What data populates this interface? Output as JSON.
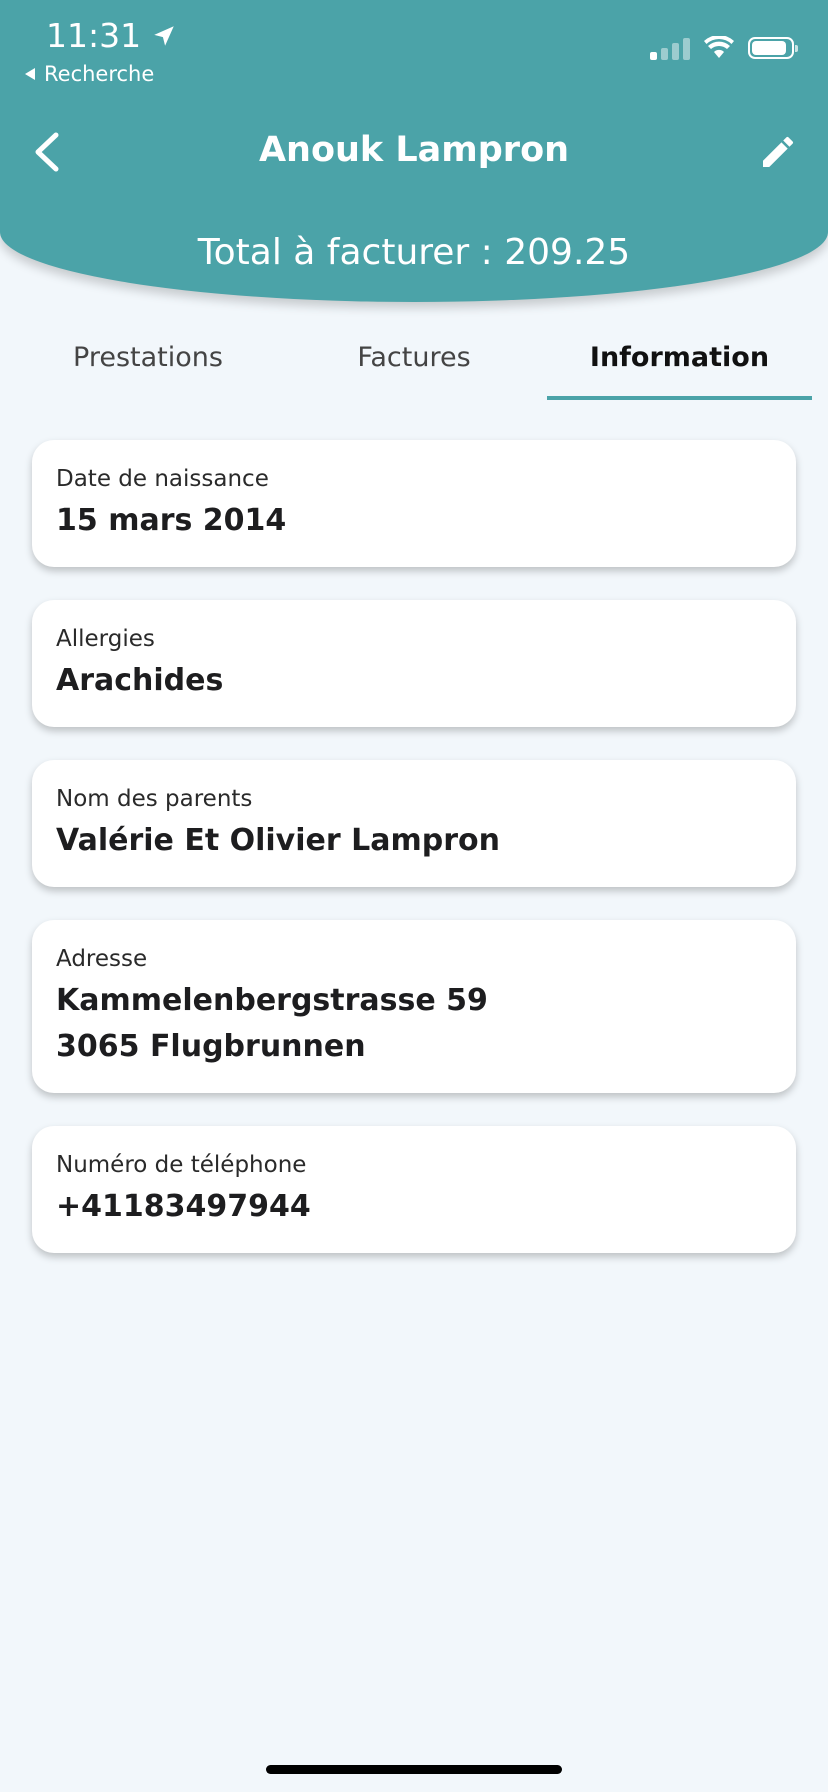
{
  "status_bar": {
    "time": "11:31",
    "back_label": "Recherche"
  },
  "header": {
    "title": "Anouk Lampron",
    "total_text": "Total à facturer : 209.25",
    "accent_color": "#4ba3a8"
  },
  "icons": {
    "location": "location-arrow-icon",
    "back": "chevron-left-icon",
    "edit": "pencil-icon",
    "signal": "cellular-signal-icon",
    "wifi": "wifi-icon",
    "battery": "battery-icon"
  },
  "tabs": [
    {
      "label": "Prestations",
      "active": false
    },
    {
      "label": "Factures",
      "active": false
    },
    {
      "label": "Information",
      "active": true
    }
  ],
  "cards": [
    {
      "label": "Date de naissance",
      "value": "15 mars 2014"
    },
    {
      "label": "Allergies",
      "value": "Arachides"
    },
    {
      "label": "Nom des parents",
      "value": "Valérie Et Olivier Lampron"
    },
    {
      "label": "Adresse",
      "value_line1": "Kammelenbergstrasse 59",
      "value_line2": "3065 Flugbrunnen"
    },
    {
      "label": "Numéro de téléphone",
      "value": "+41183497944"
    }
  ]
}
